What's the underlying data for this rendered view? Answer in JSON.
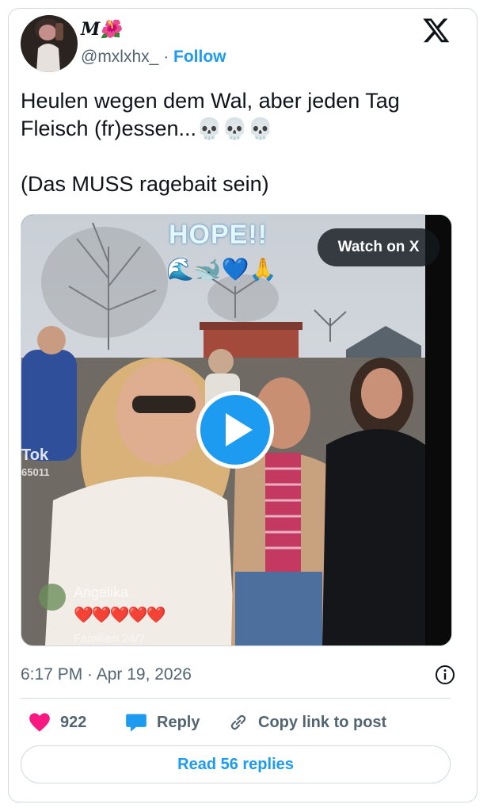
{
  "author": {
    "display_name": "M🌺",
    "handle": "@mxlxhx_",
    "separator": "·",
    "follow_label": "Follow"
  },
  "tweet": {
    "text_line1": "Heulen wegen dem Wal, aber jeden Tag",
    "text_line2": "Fleisch (fr)essen...",
    "skulls": "💀💀💀",
    "text_line3": "(Das MUSS ragebait sein)"
  },
  "media": {
    "watch_label": "Watch on X",
    "overlay_title": "HOPE!!",
    "overlay_emojis": "🌊🐋💙🙏",
    "tiktok_tag": "Tok",
    "tiktok_id": "65011",
    "comment_name": "Angelika",
    "comment_hearts": "❤️❤️❤️❤️❤️",
    "comment_faded": "Familien 24/7",
    "play_icon": "play-icon"
  },
  "meta": {
    "timestamp": "6:17 PM · Apr 19, 2026"
  },
  "actions": {
    "like_count": "922",
    "reply_label": "Reply",
    "copy_label": "Copy link to post"
  },
  "footer": {
    "read_replies_label": "Read 56 replies"
  },
  "colors": {
    "accent": "#1d9bf0",
    "like": "#f91880",
    "muted": "#536471",
    "text": "#0f1419",
    "border": "#cfd9de"
  }
}
